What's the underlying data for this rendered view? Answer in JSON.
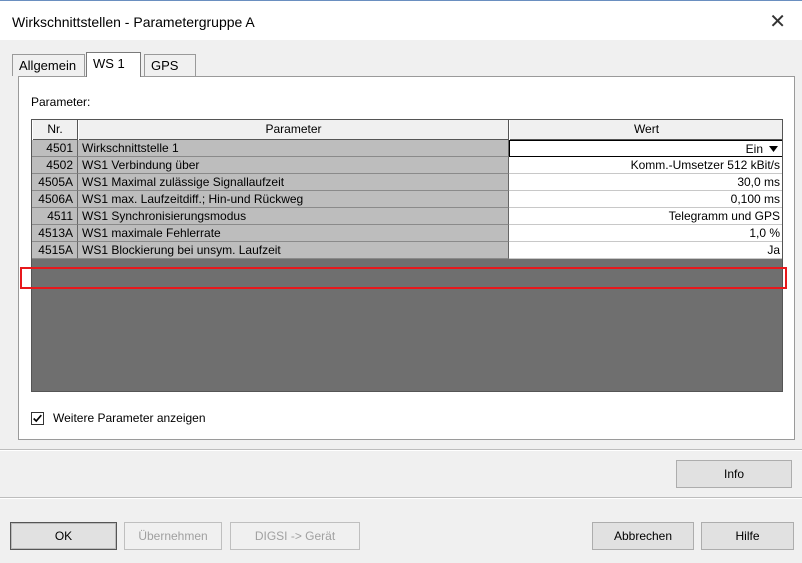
{
  "window": {
    "title": "Wirkschnittstellen - Parametergruppe A"
  },
  "tabs": [
    {
      "label": "Allgemein"
    },
    {
      "label": "WS 1"
    },
    {
      "label": "GPS"
    }
  ],
  "panel": {
    "label": "Parameter:",
    "columns": {
      "nr": "Nr.",
      "parameter": "Parameter",
      "wert": "Wert"
    },
    "rows": [
      {
        "nr": "4501",
        "parameter": "Wirkschnittstelle 1",
        "wert": "Ein"
      },
      {
        "nr": "4502",
        "parameter": "WS1 Verbindung über",
        "wert": "Komm.-Umsetzer 512 kBit/s"
      },
      {
        "nr": "4505A",
        "parameter": "WS1 Maximal zulässige Signallaufzeit",
        "wert": "30,0 ms"
      },
      {
        "nr": "4506A",
        "parameter": "WS1 max. Laufzeitdiff.; Hin-und Rückweg",
        "wert": "0,100 ms"
      },
      {
        "nr": "4511",
        "parameter": "WS1 Synchronisierungsmodus",
        "wert": "Telegramm und GPS"
      },
      {
        "nr": "4513A",
        "parameter": "WS1 maximale Fehlerrate",
        "wert": "1,0 %"
      },
      {
        "nr": "4515A",
        "parameter": "WS1 Blockierung bei unsym. Laufzeit",
        "wert": "Ja"
      }
    ],
    "show_more": {
      "label": "Weitere Parameter anzeigen",
      "checked": true
    }
  },
  "buttons": {
    "info": "Info",
    "ok": "OK",
    "apply": "Übernehmen",
    "digsi": "DIGSI -> Gerät",
    "cancel": "Abbrechen",
    "help": "Hilfe"
  },
  "colors": {
    "highlight": "#e8181c",
    "grid_bg": "#6f6f6f",
    "row_bg": "#bdbdbd"
  }
}
